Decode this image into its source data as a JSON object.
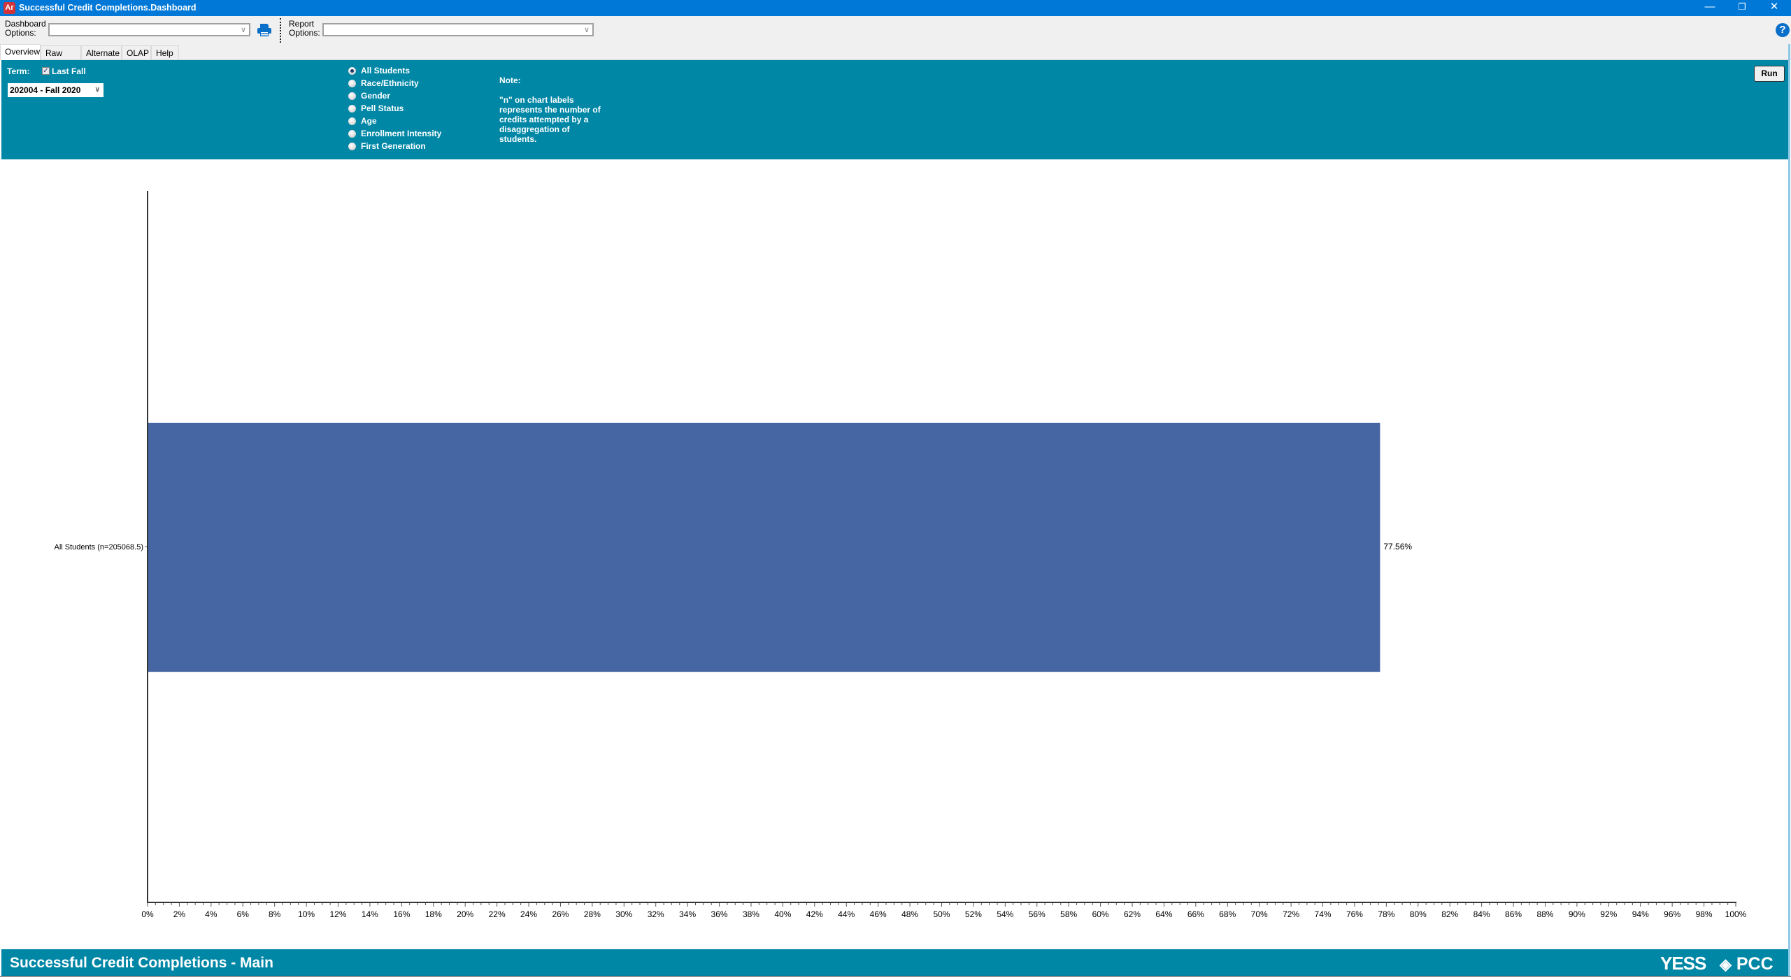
{
  "window": {
    "app_icon": "Ar",
    "title": "Successful Credit Completions.Dashboard",
    "controls": {
      "minimize": "—",
      "restore": "❐",
      "close": "✕"
    }
  },
  "toolbar": {
    "dashboard_options_label_line1": "Dashboard",
    "dashboard_options_label_line2": "Options:",
    "dashboard_options_value": "",
    "print_icon": "printer-icon",
    "report_options_label_line1": "Report",
    "report_options_label_line2": "Options:",
    "report_options_value": "",
    "help_icon": "?"
  },
  "tabs": [
    {
      "label": "Overview",
      "active": true
    },
    {
      "label": "Raw Data",
      "active": false
    },
    {
      "label": "Alternate",
      "active": false
    },
    {
      "label": "OLAP",
      "active": false
    },
    {
      "label": "Help",
      "active": false
    }
  ],
  "filters": {
    "term_label": "Term:",
    "last_fall_label": "Last Fall",
    "last_fall_checked": true,
    "term_value": "202004 - Fall 2020",
    "disaggregation_options": [
      {
        "label": "All Students",
        "selected": true
      },
      {
        "label": "Race/Ethnicity",
        "selected": false
      },
      {
        "label": "Gender",
        "selected": false
      },
      {
        "label": "Pell Status",
        "selected": false
      },
      {
        "label": "Age",
        "selected": false
      },
      {
        "label": "Enrollment Intensity",
        "selected": false
      },
      {
        "label": "First Generation",
        "selected": false
      }
    ],
    "note_title": "Note:",
    "note_text": "\"n\" on chart labels\nrepresents the number of\ncredits attempted by a\ndisaggregation of\nstudents.",
    "run_label": "Run"
  },
  "chart_data": {
    "type": "bar",
    "orientation": "horizontal",
    "title": "",
    "xlabel": "",
    "ylabel": "",
    "categories": [
      "All Students (n=205068.5)"
    ],
    "values": [
      77.56
    ],
    "value_labels": [
      "77.56%"
    ],
    "xlim": [
      0,
      100
    ],
    "major_tick_step": 2,
    "minor_tick_step": 0.5,
    "tick_format": "percent",
    "grid": false,
    "legend": "none",
    "bar_color": "#4566a2"
  },
  "footer": {
    "title": "Successful Credit Completions - Main",
    "logo_yess": "YESS",
    "logo_pcc": "PCC"
  },
  "colors": {
    "titlebar": "#0078d7",
    "panel_teal": "#0087a6",
    "accent_blue": "#0a6fc9"
  }
}
